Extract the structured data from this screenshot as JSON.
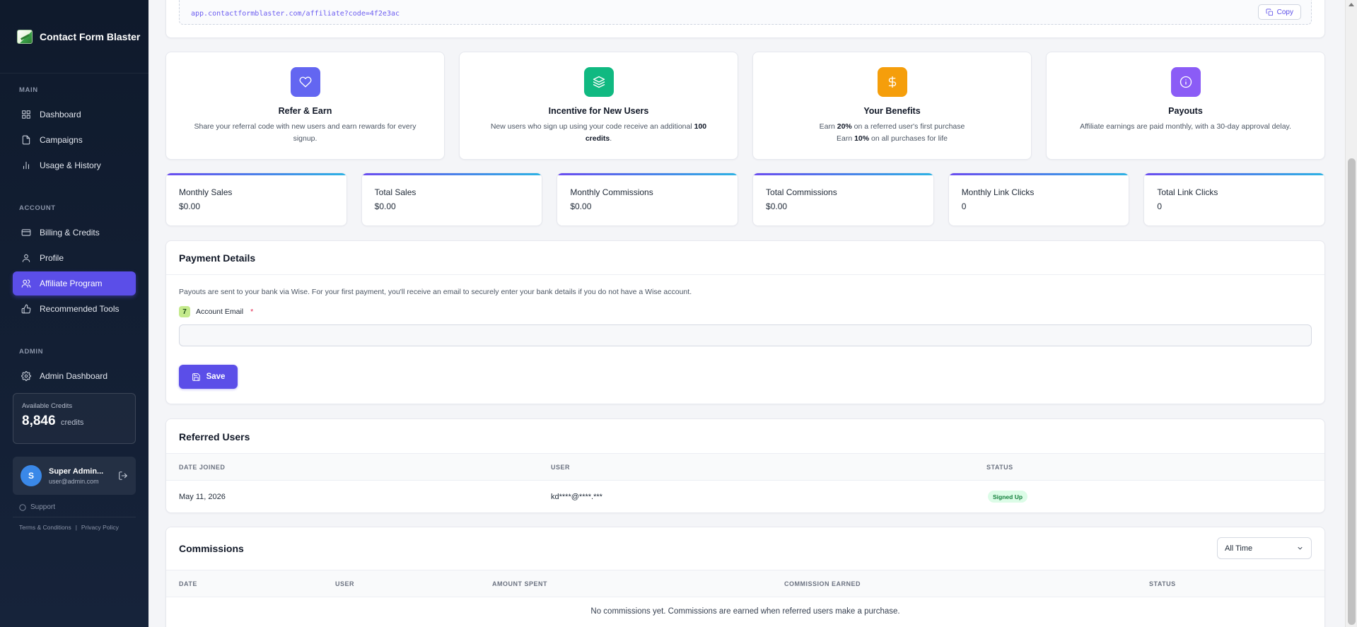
{
  "brand": {
    "name": "Contact Form Blaster"
  },
  "nav": {
    "main_heading": "MAIN",
    "account_heading": "ACCOUNT",
    "admin_heading": "ADMIN",
    "items": [
      {
        "label": "Dashboard",
        "icon": "grid-icon"
      },
      {
        "label": "Campaigns",
        "icon": "document-icon"
      },
      {
        "label": "Usage & History",
        "icon": "bar-chart-icon"
      },
      {
        "label": "Billing & Credits",
        "icon": "credit-card-icon"
      },
      {
        "label": "Profile",
        "icon": "user-icon"
      },
      {
        "label": "Affiliate Program",
        "icon": "users-icon",
        "active": true
      },
      {
        "label": "Recommended Tools",
        "icon": "thumbs-up-icon"
      },
      {
        "label": "Admin Dashboard",
        "icon": "gear-icon"
      }
    ]
  },
  "credits": {
    "label": "Available Credits",
    "value": "8,846",
    "unit": "credits"
  },
  "user": {
    "initial": "S",
    "name": "Super Admin...",
    "email": "user@admin.com"
  },
  "support": {
    "label": "Support"
  },
  "footer": {
    "terms": "Terms & Conditions",
    "separator": "|",
    "privacy": "Privacy Policy"
  },
  "referral": {
    "code": "app.contactformblaster.com/affiliate?code=4f2e3ac",
    "copy_label": "Copy"
  },
  "info_cards": [
    {
      "title": "Refer & Earn",
      "text": "Share your referral code with new users and earn rewards for every signup.",
      "icon": "heart-icon",
      "color": "#6366f1"
    },
    {
      "title": "Incentive for New Users",
      "text_pre": "New users who sign up using your code receive an additional ",
      "text_bold": "100 credits",
      "text_post": ".",
      "icon": "layers-icon",
      "color": "#10b981"
    },
    {
      "title": "Your Benefits",
      "line1_pre": "Earn ",
      "line1_bold": "20%",
      "line1_post": " on a referred user's first purchase",
      "line2_pre": "Earn ",
      "line2_bold": "10%",
      "line2_post": " on all purchases for life",
      "icon": "dollar-icon",
      "color": "#f59e0b"
    },
    {
      "title": "Payouts",
      "text": "Affiliate earnings are paid monthly, with a 30-day approval delay.",
      "icon": "info-icon",
      "color": "#8b5cf6"
    }
  ],
  "stats": [
    {
      "label": "Monthly Sales",
      "value": "$0.00"
    },
    {
      "label": "Total Sales",
      "value": "$0.00"
    },
    {
      "label": "Monthly Commissions",
      "value": "$0.00"
    },
    {
      "label": "Total Commissions",
      "value": "$0.00"
    },
    {
      "label": "Monthly Link Clicks",
      "value": "0"
    },
    {
      "label": "Total Link Clicks",
      "value": "0"
    }
  ],
  "payment": {
    "title": "Payment Details",
    "note": "Payouts are sent to your bank via Wise. For your first payment, you'll receive an email to securely enter your bank details if you do not have a Wise account.",
    "field_label": "Account Email",
    "required_mark": "*",
    "email_value": "",
    "save_label": "Save"
  },
  "referred": {
    "title": "Referred Users",
    "columns": [
      "DATE JOINED",
      "USER",
      "STATUS"
    ],
    "rows": [
      {
        "date": "May 11, 2026",
        "user": "kd****@****.***",
        "status": "Signed Up"
      }
    ]
  },
  "commissions": {
    "title": "Commissions",
    "filter_value": "All Time",
    "columns": [
      "DATE",
      "USER",
      "AMOUNT SPENT",
      "COMMISSION EARNED",
      "STATUS"
    ],
    "empty_message": "No commissions yet. Commissions are earned when referred users make a purchase."
  }
}
